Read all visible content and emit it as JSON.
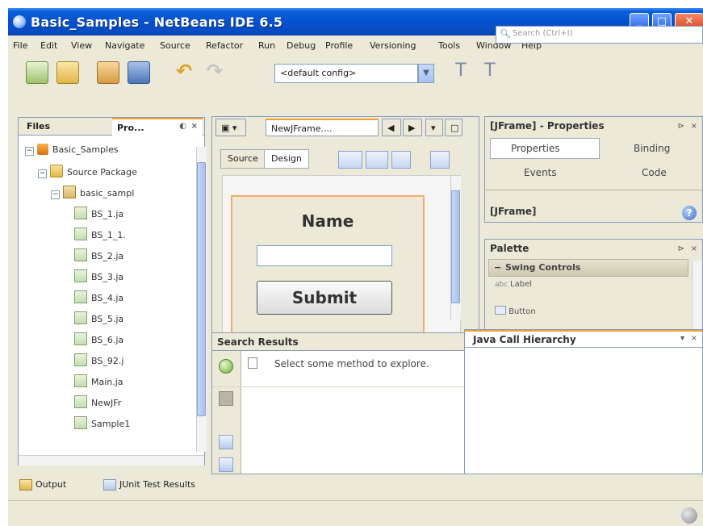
{
  "window": {
    "title": "Basic_Samples - NetBeans IDE 6.5"
  },
  "menu": [
    "File",
    "Edit",
    "View",
    "Navigate",
    "Source",
    "Refactor",
    "Run",
    "Debug",
    "Profile",
    "Versioning",
    "Tools",
    "Window",
    "Help"
  ],
  "toolbar": {
    "config_value": "<default config>",
    "search_placeholder": "Search (Ctrl+I)"
  },
  "left_panel": {
    "tabs": [
      "Files",
      "Pro..."
    ],
    "tree": [
      {
        "label": "Basic_Samples",
        "icon": "project-icon",
        "level": 0,
        "expander": "−"
      },
      {
        "label": "Source Package",
        "icon": "source-folder-icon",
        "level": 1,
        "expander": "−"
      },
      {
        "label": "basic_sampl",
        "icon": "package-icon",
        "level": 2,
        "expander": "−"
      },
      {
        "label": "BS_1.ja",
        "icon": "java-file-icon",
        "level": 3
      },
      {
        "label": "BS_1_1.",
        "icon": "java-file-icon",
        "level": 3
      },
      {
        "label": "BS_2.ja",
        "icon": "java-file-icon",
        "level": 3
      },
      {
        "label": "BS_3.ja",
        "icon": "java-file-icon",
        "level": 3
      },
      {
        "label": "BS_4.ja",
        "icon": "java-file-icon",
        "level": 3
      },
      {
        "label": "BS_5.ja",
        "icon": "java-file-icon",
        "level": 3
      },
      {
        "label": "BS_6.ja",
        "icon": "java-file-icon",
        "level": 3
      },
      {
        "label": "BS_92.j",
        "icon": "java-file-icon",
        "level": 3
      },
      {
        "label": "Main.ja",
        "icon": "java-main-icon",
        "level": 3
      },
      {
        "label": "NewJFr",
        "icon": "java-file-icon",
        "level": 3
      },
      {
        "label": "Sample1",
        "icon": "java-file-icon",
        "level": 3
      }
    ]
  },
  "editor": {
    "tab_label": "NewJFrame....",
    "subtabs": [
      "Source",
      "Design"
    ],
    "form": {
      "name_label": "Name",
      "submit_label": "Submit"
    }
  },
  "properties": {
    "title": "[JFrame] - Properties",
    "tabs": [
      "Properties",
      "Binding",
      "Events",
      "Code"
    ],
    "selected_component": "[JFrame]"
  },
  "palette": {
    "title": "Palette",
    "category": "Swing Controls",
    "items": [
      "Label",
      "Button"
    ]
  },
  "search_results": {
    "title": "Search Results",
    "message": "Select some method to explore."
  },
  "call_hierarchy": {
    "title": "Java Call Hierarchy"
  },
  "bottom_tabs": [
    "Output",
    "JUnit Test Results"
  ]
}
